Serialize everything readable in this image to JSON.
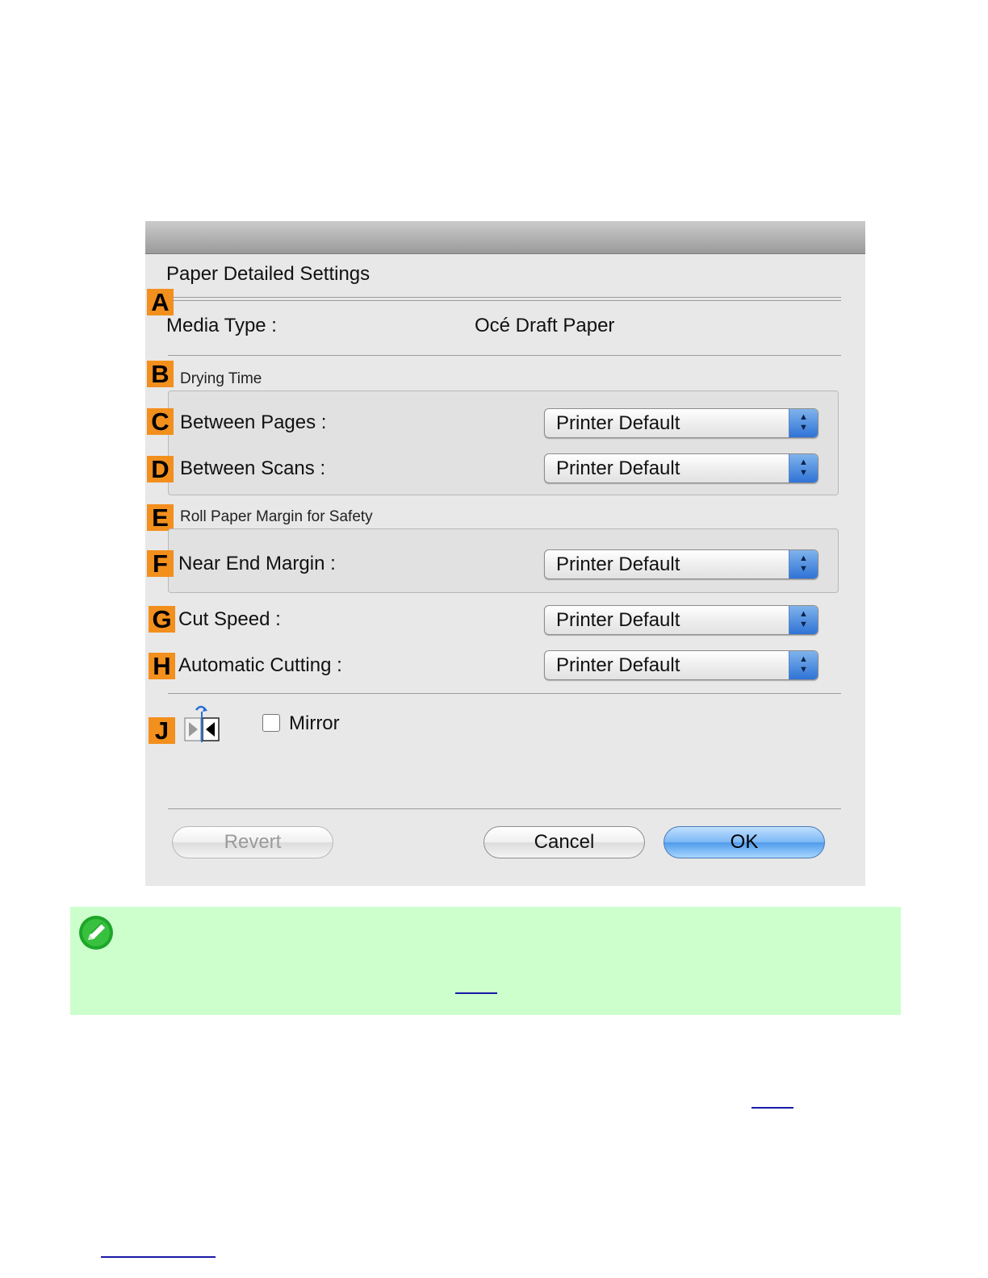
{
  "dialog": {
    "title": "Paper Detailed Settings",
    "media_type": {
      "badge": "A",
      "label": "Media Type :",
      "value": "Océ Draft Paper"
    },
    "drying_time": {
      "badge": "B",
      "title": "Drying Time",
      "between_pages": {
        "badge": "C",
        "label": "Between Pages :",
        "value": "Printer Default"
      },
      "between_scans": {
        "badge": "D",
        "label": "Between Scans :",
        "value": "Printer Default"
      }
    },
    "roll_margin": {
      "badge": "E",
      "title": "Roll Paper Margin for Safety",
      "near_end_margin": {
        "badge": "F",
        "label": "Near End Margin :",
        "value": "Printer Default"
      }
    },
    "cut_speed": {
      "badge": "G",
      "label": "Cut Speed :",
      "value": "Printer Default"
    },
    "automatic_cutting": {
      "badge": "H",
      "label": "Automatic Cutting :",
      "value": "Printer Default"
    },
    "mirror": {
      "badge": "J",
      "label": "Mirror",
      "checked": false
    },
    "buttons": {
      "revert": "Revert",
      "cancel": "Cancel",
      "ok": "OK"
    }
  },
  "icons": {
    "mirror_preview": "mirror-preview-icon",
    "note": "note-pencil-icon"
  },
  "colors": {
    "badge": "#f28f1d",
    "note_background": "#ccffcc",
    "link": "#1a1aa6",
    "ok_button": "#5aa2ee"
  }
}
